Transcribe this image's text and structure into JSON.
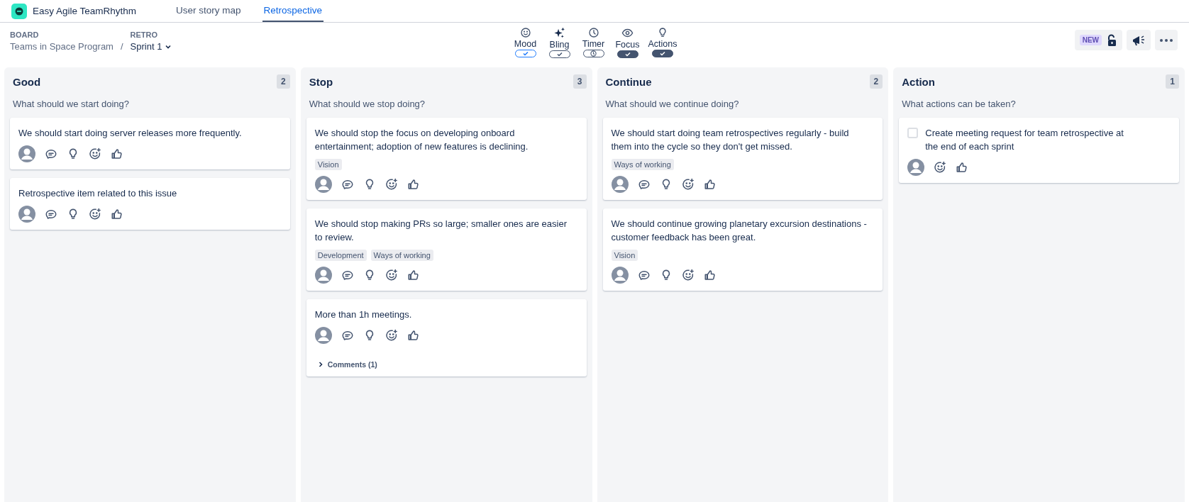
{
  "app": {
    "name": "Easy Agile TeamRhythm"
  },
  "tabs": [
    {
      "label": "User story map",
      "selected": false
    },
    {
      "label": "Retrospective",
      "selected": true
    }
  ],
  "breadcrumb": {
    "board_label": "BOARD",
    "board": "Teams in Space Program",
    "separator": "/",
    "retro_label": "RETRO",
    "retro": "Sprint 1"
  },
  "toggles": [
    {
      "label": "Mood",
      "kind": "check",
      "on": false,
      "selected": true
    },
    {
      "label": "Bling",
      "kind": "check",
      "on": false,
      "selected": false
    },
    {
      "label": "Timer",
      "kind": "timer",
      "on": false,
      "selected": false
    },
    {
      "label": "Focus",
      "kind": "check",
      "on": true,
      "selected": false
    },
    {
      "label": "Actions",
      "kind": "check",
      "on": true,
      "selected": false
    }
  ],
  "new_badge": "NEW",
  "columns": [
    {
      "title": "Good",
      "count": "2",
      "prompt": "What should we start doing?",
      "cards": [
        {
          "kind": "item",
          "text": "We should start doing server releases more frequently."
        },
        {
          "kind": "item",
          "text": "Retrospective item related to this issue"
        }
      ]
    },
    {
      "title": "Stop",
      "count": "3",
      "prompt": "What should we stop doing?",
      "cards": [
        {
          "kind": "item",
          "text": "We should stop the focus on developing onboard entertainment; adoption of new features is declining.",
          "tags": [
            "Vision"
          ]
        },
        {
          "kind": "item",
          "text": "We should stop making PRs so large; smaller ones are easier to review.",
          "tags": [
            "Development",
            "Ways of working"
          ]
        },
        {
          "kind": "item",
          "text": "More than 1h meetings.",
          "comments": "Comments (1)"
        }
      ]
    },
    {
      "title": "Continue",
      "count": "2",
      "prompt": "What should we continue doing?",
      "cards": [
        {
          "kind": "item",
          "text": "We should start doing team retrospectives regularly - build them into the cycle so they don't get missed.",
          "tags": [
            "Ways of working"
          ]
        },
        {
          "kind": "item",
          "text": "We should continue growing planetary excursion destinations - customer feedback has been great.",
          "tags": [
            "Vision"
          ]
        }
      ]
    },
    {
      "title": "Action",
      "count": "1",
      "prompt": "What actions can be taken?",
      "cards": [
        {
          "kind": "action",
          "checked": false,
          "text": "Create meeting request for team retrospective at the end of each sprint"
        }
      ]
    }
  ]
}
